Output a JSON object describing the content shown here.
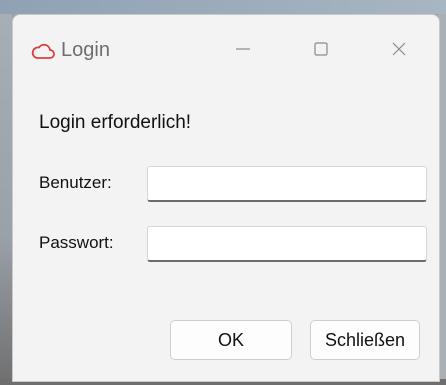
{
  "window": {
    "title": "Login",
    "icon": "cloud-outline-icon",
    "accent_color": "#d9423a",
    "controls": {
      "minimize_icon": "minimize-icon",
      "maximize_icon": "maximize-icon",
      "close_icon": "close-icon"
    }
  },
  "form": {
    "heading": "Login erforderlich!",
    "user_label": "Benutzer:",
    "user_value": "",
    "password_label": "Passwort:",
    "password_value": ""
  },
  "buttons": {
    "ok_label": "OK",
    "close_label": "Schließen"
  }
}
